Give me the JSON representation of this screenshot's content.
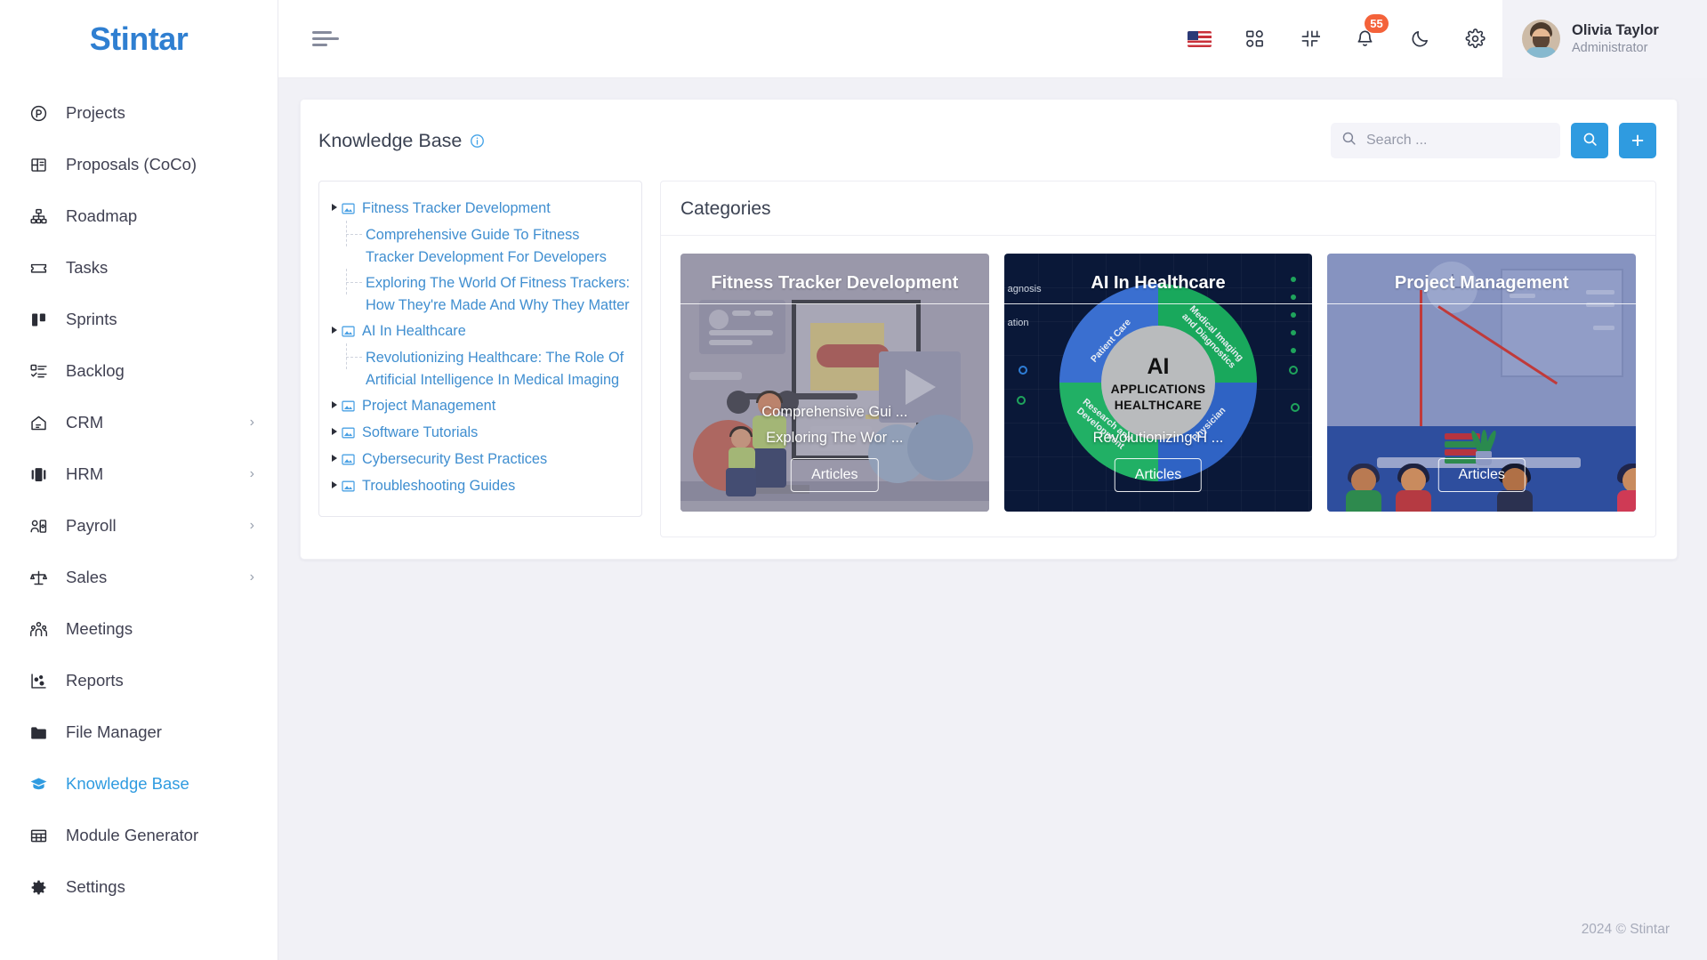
{
  "brand": {
    "name": "Stintar"
  },
  "sidebar": {
    "items": [
      {
        "label": "Projects",
        "icon": "projects-icon",
        "has_submenu": false,
        "active": false
      },
      {
        "label": "Proposals (CoCo)",
        "icon": "proposals-icon",
        "has_submenu": false,
        "active": false
      },
      {
        "label": "Roadmap",
        "icon": "roadmap-icon",
        "has_submenu": false,
        "active": false
      },
      {
        "label": "Tasks",
        "icon": "tasks-icon",
        "has_submenu": false,
        "active": false
      },
      {
        "label": "Sprints",
        "icon": "sprints-icon",
        "has_submenu": false,
        "active": false
      },
      {
        "label": "Backlog",
        "icon": "backlog-icon",
        "has_submenu": false,
        "active": false
      },
      {
        "label": "CRM",
        "icon": "crm-icon",
        "has_submenu": true,
        "active": false
      },
      {
        "label": "HRM",
        "icon": "hrm-icon",
        "has_submenu": true,
        "active": false
      },
      {
        "label": "Payroll",
        "icon": "payroll-icon",
        "has_submenu": true,
        "active": false
      },
      {
        "label": "Sales",
        "icon": "sales-icon",
        "has_submenu": true,
        "active": false
      },
      {
        "label": "Meetings",
        "icon": "meetings-icon",
        "has_submenu": false,
        "active": false
      },
      {
        "label": "Reports",
        "icon": "reports-icon",
        "has_submenu": false,
        "active": false
      },
      {
        "label": "File Manager",
        "icon": "folder-icon",
        "has_submenu": false,
        "active": false
      },
      {
        "label": "Knowledge Base",
        "icon": "graduation-cap-icon",
        "has_submenu": false,
        "active": true
      },
      {
        "label": "Module Generator",
        "icon": "grid-table-icon",
        "has_submenu": false,
        "active": false
      },
      {
        "label": "Settings",
        "icon": "gear-icon",
        "has_submenu": false,
        "active": false
      }
    ],
    "submenu_chevron": "›",
    "active_color": "#2f9be0"
  },
  "topbar": {
    "menu_toggle": "hamburger-icon",
    "icons": [
      "flag-us-icon",
      "apps-grid-icon",
      "collapse-fullscreen-icon",
      "bell-icon",
      "moon-icon",
      "gear-icon"
    ],
    "notification_count": "55",
    "notification_color": "#f4623a",
    "user": {
      "name": "Olivia Taylor",
      "role": "Administrator"
    }
  },
  "page": {
    "title": "Knowledge Base",
    "info_icon": "info-circle-icon"
  },
  "search": {
    "placeholder": "Search ...",
    "value": "",
    "icon": "search-icon",
    "submit_icon": "search-icon",
    "add_label": "+",
    "accent": "#2f9be0"
  },
  "tree": {
    "nodes": [
      {
        "label": "Fitness Tracker Development",
        "icon": "image-node-icon",
        "expanded": true,
        "children": [
          "Comprehensive Guide To Fitness Tracker Development For Developers",
          "Exploring The World Of Fitness Trackers: How They're Made And Why They Matter"
        ]
      },
      {
        "label": "AI In Healthcare",
        "icon": "image-node-icon",
        "expanded": true,
        "children": [
          "Revolutionizing Healthcare: The Role Of Artificial Intelligence In Medical Imaging"
        ]
      },
      {
        "label": "Project Management",
        "icon": "image-node-icon",
        "expanded": false,
        "children": []
      },
      {
        "label": "Software Tutorials",
        "icon": "image-node-icon",
        "expanded": false,
        "children": []
      },
      {
        "label": "Cybersecurity Best Practices",
        "icon": "image-node-icon",
        "expanded": false,
        "children": []
      },
      {
        "label": "Troubleshooting Guides",
        "icon": "image-node-icon",
        "expanded": false,
        "children": []
      }
    ]
  },
  "categories": {
    "heading": "Categories",
    "cards": [
      {
        "title": "Fitness Tracker Development",
        "articles": [
          "Comprehensive Gui ...",
          "Exploring The Wor ..."
        ],
        "button": "Articles"
      },
      {
        "title": "AI In Healthcare",
        "articles": [
          "Revolutionizing H ..."
        ],
        "button": "Articles",
        "diagram": {
          "center": [
            "AI",
            "APPLICATIONS",
            "HEALTHCARE"
          ],
          "segments": [
            "Patient Care",
            "Medical Imaging and Diagnostics",
            "Research and Development",
            "Physician"
          ],
          "side_text": [
            "agnosis",
            "ation"
          ]
        }
      },
      {
        "title": "Project Management",
        "articles": [],
        "button": "Articles"
      }
    ]
  },
  "footer": {
    "text": "2024 © Stintar"
  }
}
